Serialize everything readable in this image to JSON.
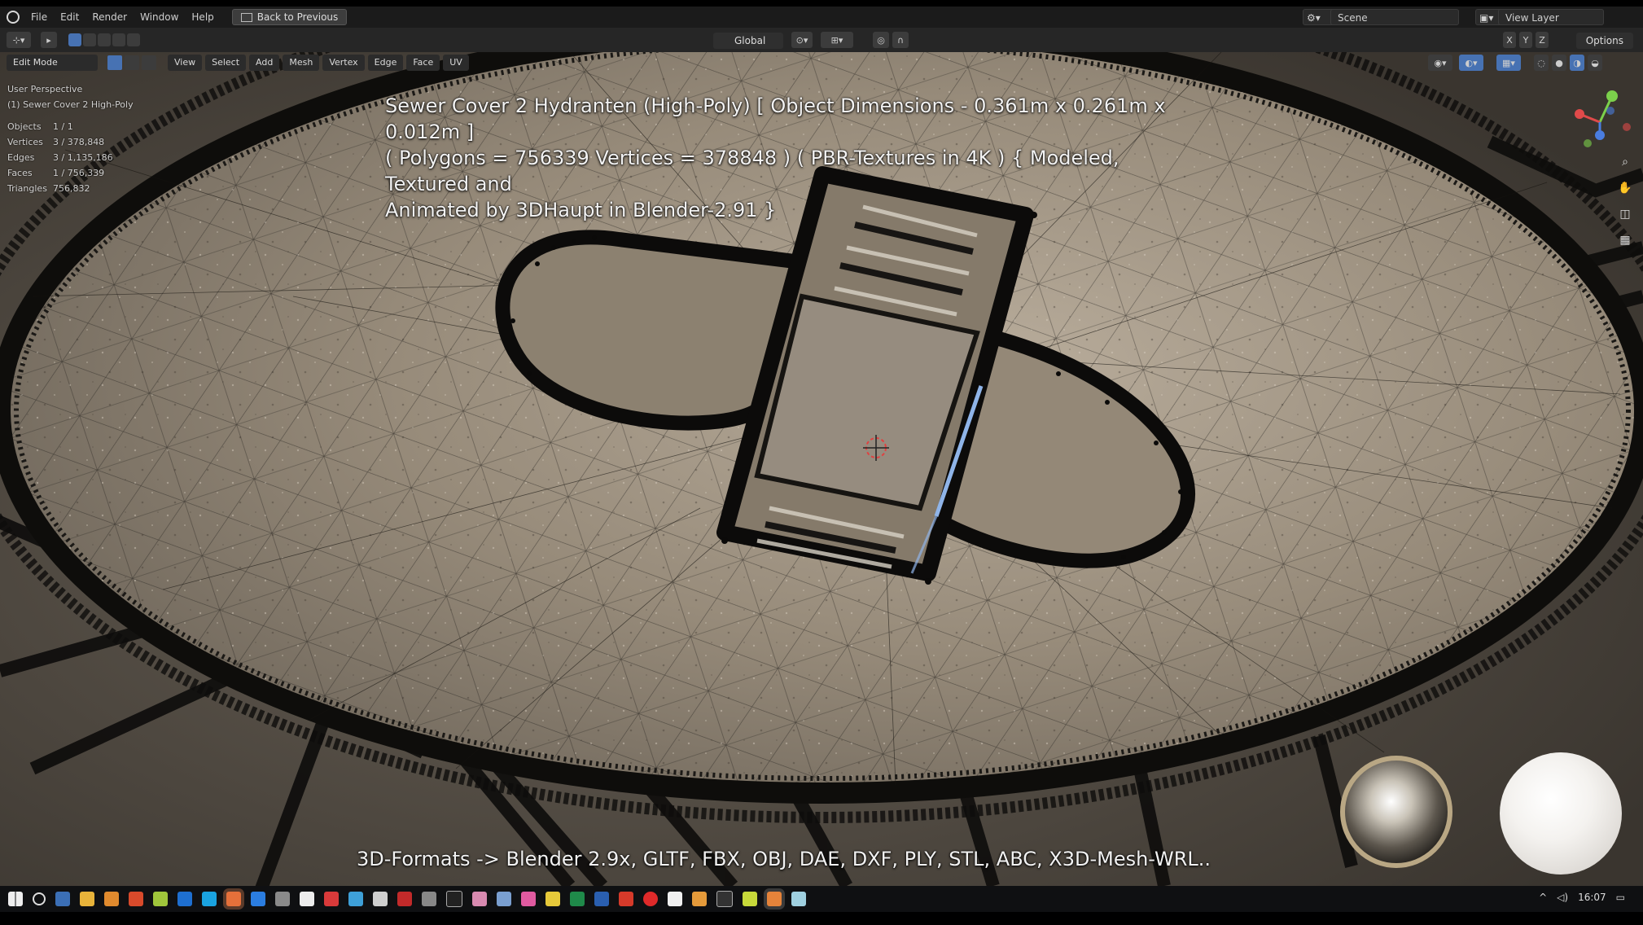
{
  "menubar": {
    "items": [
      "File",
      "Edit",
      "Render",
      "Window",
      "Help"
    ],
    "back_button": "Back to Previous",
    "scene": "Scene",
    "view_layer": "View Layer"
  },
  "toolheader": {
    "orientation": "Global",
    "options": "Options"
  },
  "viewport_header": {
    "mode": "Edit Mode",
    "menus": [
      "View",
      "Select",
      "Add",
      "Mesh",
      "Vertex",
      "Edge",
      "Face",
      "UV"
    ]
  },
  "stats": {
    "view_name": "User Perspective",
    "object_name": "(1) Sewer Cover 2 High-Poly",
    "rows": [
      {
        "label": "Objects",
        "value": "1 / 1"
      },
      {
        "label": "Vertices",
        "value": "3 / 378,848"
      },
      {
        "label": "Edges",
        "value": "3 / 1,135,186"
      },
      {
        "label": "Faces",
        "value": "1 / 756,339"
      },
      {
        "label": "Triangles",
        "value": "756,832"
      }
    ]
  },
  "overlay": {
    "title_lines": [
      "Sewer Cover 2 Hydranten (High-Poly) [ Object Dimensions -  0.361m x 0.261m x 0.012m ]",
      "( Polygons = 756339 Vertices = 378848 ) ( PBR-Textures in 4K ) { Modeled, Textured and",
      "Animated by 3DHaupt in Blender-2.91 }"
    ],
    "formats": "3D-Formats -> Blender 2.9x, GLTF, FBX, OBJ, DAE, DXF, PLY, STL, ABC, X3D-Mesh-WRL.."
  },
  "taskbar": {
    "time": "16:07"
  },
  "colors": {
    "surface": "#8a7f70",
    "mesh_dark": "#121110",
    "selected_edge": "#8fb4e8",
    "ui_dark": "#1b1b1b",
    "active_blue": "#4772b3"
  },
  "icons": [
    "blender-logo-icon",
    "cursor-icon",
    "vertex-select-icon",
    "edge-select-icon",
    "face-select-icon",
    "gizmo-axes-icon",
    "zoom-icon",
    "hand-pan-icon",
    "camera-icon",
    "grid-icon",
    "windows-start-icon",
    "search-icon"
  ]
}
